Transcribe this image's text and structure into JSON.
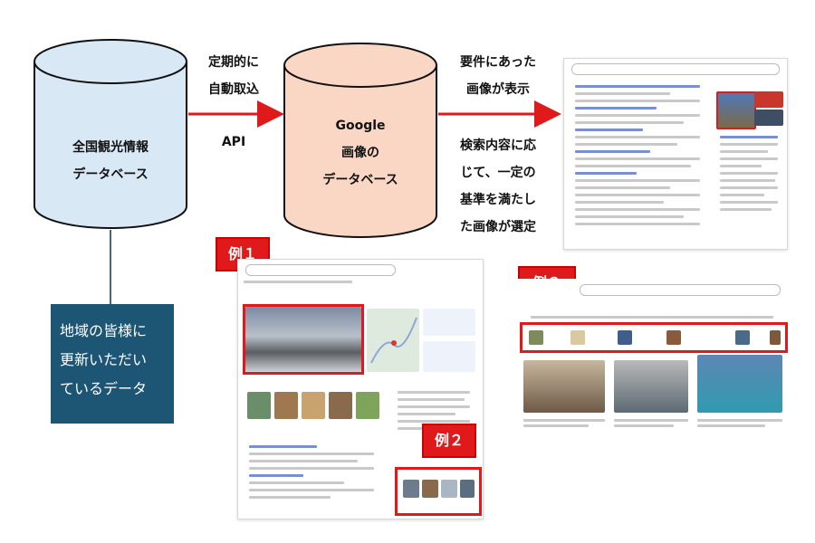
{
  "cylinders": {
    "left": {
      "lines": [
        "全国観光情報",
        "データベース"
      ]
    },
    "right": {
      "lines": [
        "Google",
        "画像の",
        "データベース"
      ]
    }
  },
  "arrow1": {
    "lines": [
      "定期的に",
      "自動取込"
    ],
    "api": "API"
  },
  "arrow2": {
    "top_lines": [
      "要件にあった",
      "画像が表示"
    ],
    "bottom_lines": [
      "検索内容に応",
      "じて、一定の",
      "基準を満たし",
      "た画像が選定"
    ]
  },
  "community_box": {
    "lines": [
      "地域の皆様に",
      "更新いただい",
      "ているデータ"
    ]
  },
  "examples": {
    "ex1": "例１",
    "ex2": "例２",
    "ex3": "例３"
  },
  "colors": {
    "red": "#e0191b",
    "cyl_left": "#d9e8f5",
    "cyl_right": "#f9d7c4",
    "box": "#1d5574"
  }
}
